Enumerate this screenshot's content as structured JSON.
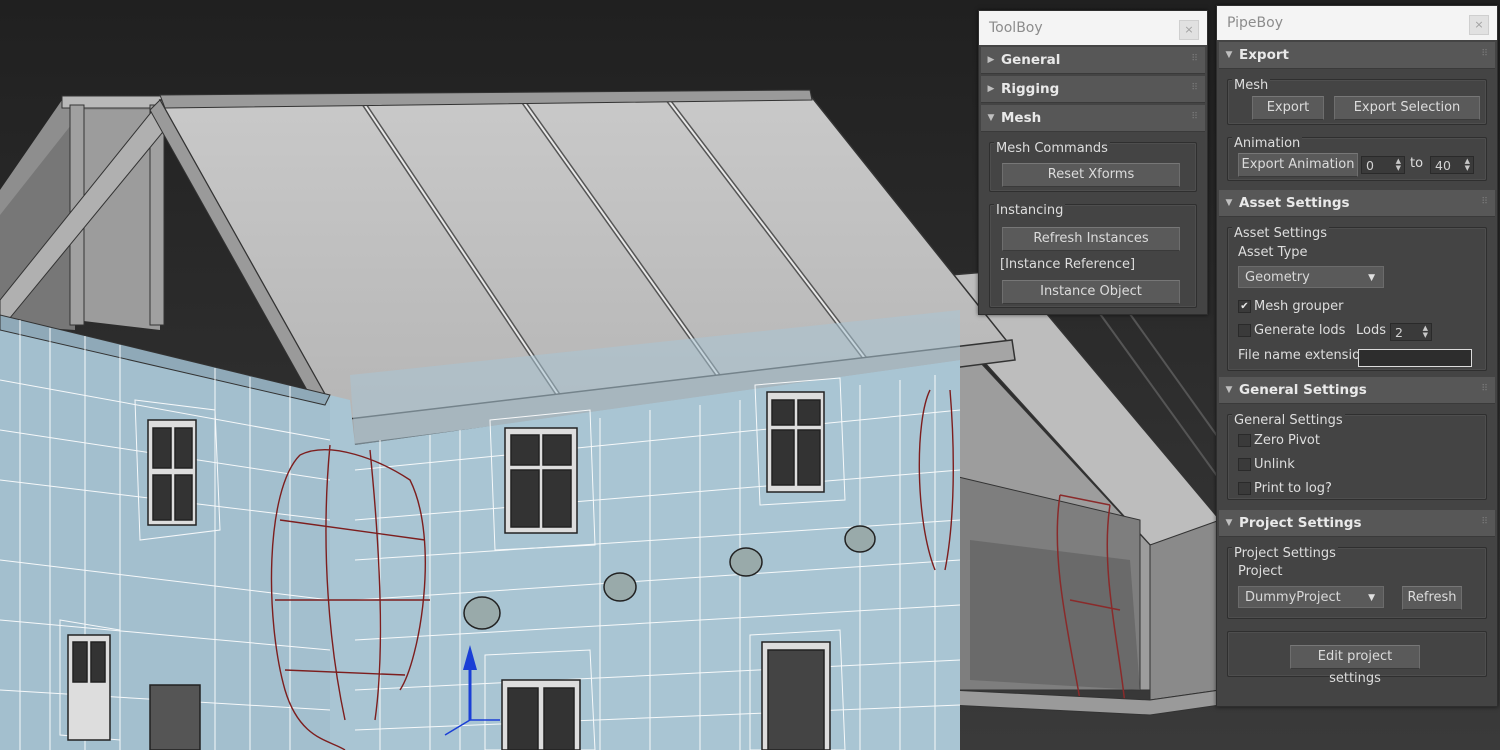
{
  "toolboy": {
    "title": "ToolBoy",
    "close": "×",
    "rollouts": {
      "general": "General",
      "rigging": "Rigging",
      "mesh": "Mesh"
    },
    "mesh": {
      "commands_title": "Mesh Commands",
      "reset_xforms": "Reset Xforms",
      "instancing_title": "Instancing",
      "refresh_instances": "Refresh Instances",
      "instance_reference": "[Instance Reference]",
      "instance_object": "Instance Object"
    }
  },
  "pipeboy": {
    "title": "PipeBoy",
    "close": "×",
    "export": {
      "rollout": "Export",
      "mesh_group": "Mesh",
      "export_btn": "Export",
      "export_selection_btn": "Export Selection",
      "animation_group": "Animation",
      "export_animation_btn": "Export Animation",
      "from": "0",
      "to_label": "to",
      "to": "40"
    },
    "asset": {
      "rollout": "Asset Settings",
      "group": "Asset Settings",
      "asset_type_label": "Asset Type",
      "asset_type": "Geometry",
      "mesh_grouper": "Mesh grouper",
      "mesh_grouper_checked": true,
      "generate_lods": "Generate lods",
      "generate_lods_checked": false,
      "lods_label": "Lods",
      "lods": "2",
      "file_ext_label": "File name extension",
      "file_ext_value": ""
    },
    "general": {
      "rollout": "General Settings",
      "group": "General Settings",
      "zero_pivot": "Zero Pivot",
      "unlink": "Unlink",
      "print_log": "Print to log?"
    },
    "project": {
      "rollout": "Project Settings",
      "group": "Project Settings",
      "project_label": "Project",
      "project": "DummyProject",
      "refresh_btn": "Refresh",
      "edit_btn": "Edit project settings"
    }
  },
  "glyphs": {
    "expanded": "▼",
    "collapsed": "▶",
    "grip": "⠿",
    "spin": "▲▼",
    "check": "✔",
    "dropdown": "▼"
  },
  "colors": {
    "viewport_bg": "#2b2b2b",
    "selected_face": "#a9c5d3",
    "wire": "#ffffff",
    "panel_bg": "#444444",
    "rollout_bg": "#575757"
  }
}
